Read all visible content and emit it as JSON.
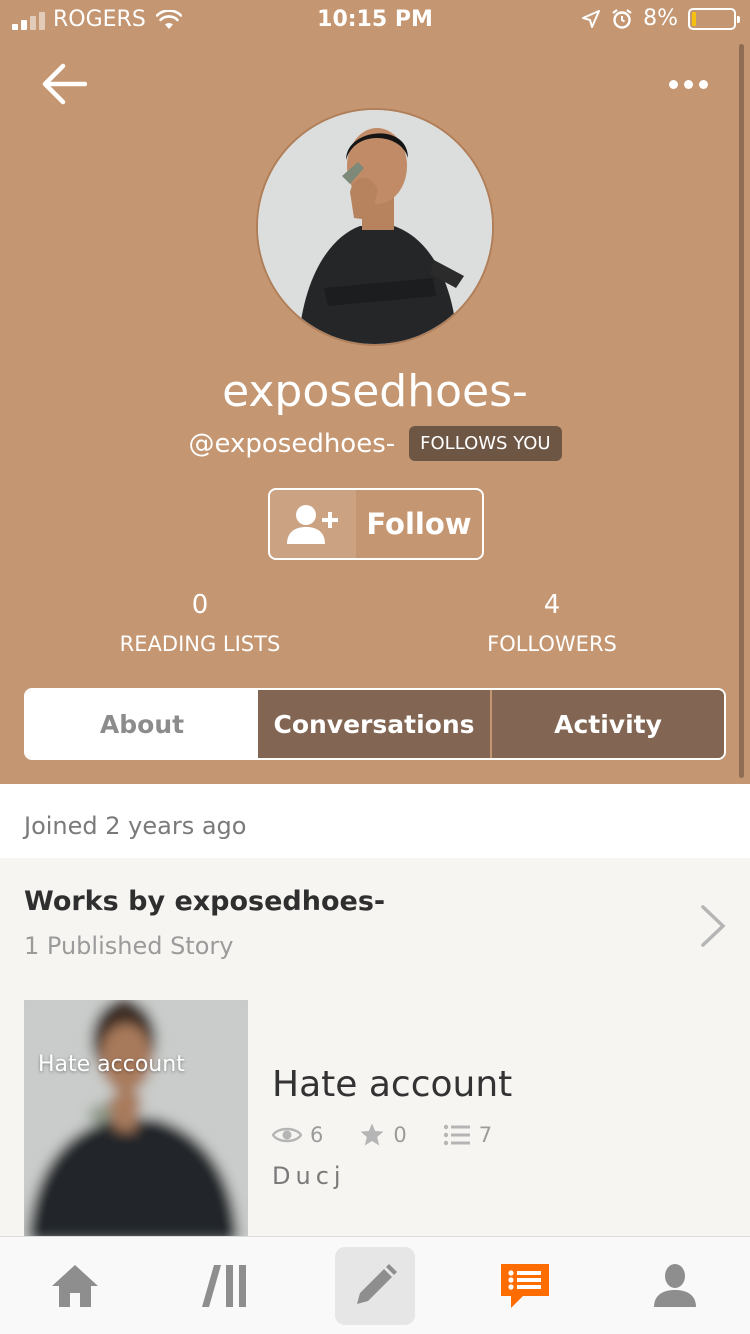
{
  "status_bar": {
    "carrier": "ROGERS",
    "time": "10:15 PM",
    "battery": "8%"
  },
  "header": {
    "display_name": "exposedhoes-",
    "handle": "@exposedhoes-",
    "follows_badge": "FOLLOWS YOU",
    "follow_label": "Follow"
  },
  "stats": {
    "reading_lists": {
      "value": "0",
      "label": "READING LISTS"
    },
    "followers": {
      "value": "4",
      "label": "FOLLOWERS"
    }
  },
  "tabs": [
    {
      "label": "About",
      "active": true
    },
    {
      "label": "Conversations",
      "active": false
    },
    {
      "label": "Activity",
      "active": false
    }
  ],
  "about": {
    "joined": "Joined 2 years ago"
  },
  "works": {
    "title": "Works by exposedhoes-",
    "subtitle": "1 Published Story",
    "story": {
      "cover_text": "Hate account",
      "title": "Hate account",
      "reads": "6",
      "votes": "0",
      "parts": "7",
      "description": "Ducj"
    }
  },
  "bottom_nav": {
    "active": "messages",
    "accent": "#ff6d00"
  },
  "colors": {
    "header_bg": "#c49671",
    "tab_inactive": "#826653"
  }
}
